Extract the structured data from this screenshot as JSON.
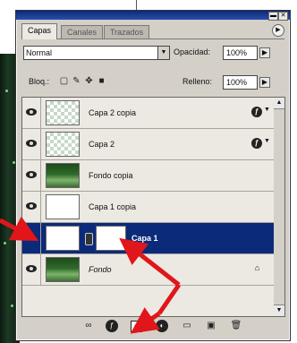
{
  "panel": {
    "tabs": [
      {
        "label": "Capas",
        "active": true
      },
      {
        "label": "Canales",
        "active": false
      },
      {
        "label": "Trazados",
        "active": false
      }
    ],
    "blend_mode": "Normal",
    "opacity_label": "Opacidad:",
    "opacity_value": "100%",
    "lock_label": "Bloq.:",
    "fill_label": "Relleno:",
    "fill_value": "100%"
  },
  "layers": [
    {
      "name": "Capa 2 copia",
      "thumb": "checker",
      "fx": true,
      "selected": false
    },
    {
      "name": "Capa 2",
      "thumb": "checker",
      "fx": true,
      "selected": false
    },
    {
      "name": "Fondo copia",
      "thumb": "photo",
      "fx": false,
      "selected": false
    },
    {
      "name": "Capa 1 copia",
      "thumb": "white",
      "fx": false,
      "selected": false
    },
    {
      "name": "Capa 1",
      "thumb": "white",
      "mask": true,
      "fx": false,
      "selected": true
    },
    {
      "name": "Fondo",
      "thumb": "photo",
      "fx": false,
      "locked": true,
      "italic": true,
      "selected": false
    }
  ],
  "icons": {
    "title_minimize": "minimize-icon",
    "title_close": "close-icon",
    "panel_menu": "panel-menu-icon",
    "lock_transparency": "lock-transparency-icon",
    "lock_paint": "lock-paint-icon",
    "lock_move": "lock-move-icon",
    "lock_all": "lock-all-icon",
    "bottom": [
      "link-layers-icon",
      "add-layer-style-icon",
      "add-layer-mask-icon",
      "new-adjustment-layer-icon",
      "new-group-icon",
      "new-layer-icon",
      "delete-layer-icon"
    ]
  },
  "colors": {
    "selection": "#0c2a7a",
    "annotation_arrow": "#e0161b"
  }
}
